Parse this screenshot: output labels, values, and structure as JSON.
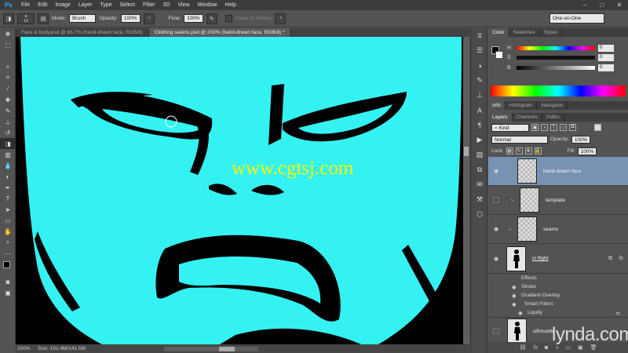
{
  "app_logo": "Ps",
  "menu": [
    "File",
    "Edit",
    "Image",
    "Layer",
    "Type",
    "Select",
    "Filter",
    "3D",
    "View",
    "Window",
    "Help"
  ],
  "window_controls": [
    "–",
    "□",
    "✕"
  ],
  "options": {
    "brush_size": "13",
    "mode_label": "Mode:",
    "mode_value": "Brush",
    "opacity_label": "Opacity:",
    "opacity_value": "100%",
    "flow_label": "Flow:",
    "flow_value": "100%",
    "erase_history": "Erase to History",
    "workspace": "One-on-One"
  },
  "doc_tabs": [
    {
      "label": "Face & body.psd @ 66.7% (hand-drawn face, RGB/8)"
    },
    {
      "label": "Clothing seams.psd @ 200% (hand-drawn face, RGB/8) *"
    }
  ],
  "status": {
    "zoom": "200%",
    "doc": "Doc: 101.4M/141.5M"
  },
  "color_panel": {
    "tabs": [
      "Color",
      "Swatches",
      "Styles"
    ],
    "channels": [
      {
        "label": "H",
        "value": "0"
      },
      {
        "label": "S",
        "value": "0"
      },
      {
        "label": "B",
        "value": "0"
      }
    ]
  },
  "info_tabs": [
    "Info",
    "Histogram",
    "Navigator"
  ],
  "layers_panel": {
    "tabs": [
      "Layers",
      "Channels",
      "Paths"
    ],
    "kind": "Kind",
    "blend_mode": "Normal",
    "opacity_label": "Opacity:",
    "opacity_value": "100%",
    "lock_label": "Lock:",
    "fill_label": "Fill:",
    "fill_value": "100%",
    "layers": [
      {
        "name": "hand-drawn face",
        "active": true,
        "visible": true
      },
      {
        "name": "template",
        "active": false,
        "visible": false
      },
      {
        "name": "seams",
        "active": false,
        "visible": true
      }
    ],
    "smart_layer": {
      "name": "in flight",
      "effects_label": "Effects",
      "effects": [
        "Stroke",
        "Gradient Overlay"
      ],
      "smart_filters_label": "Smart Filters",
      "smart_filters": [
        "Liquify"
      ]
    },
    "bottom_layer": {
      "name": "silhouette"
    }
  },
  "watermark": "www.cgtsj.com",
  "brand": "lynda.com",
  "colors": {
    "canvas_fill": "#35f2f2",
    "ink": "#000000",
    "active_layer": "#7792b2",
    "watermark": "#f5f500"
  }
}
